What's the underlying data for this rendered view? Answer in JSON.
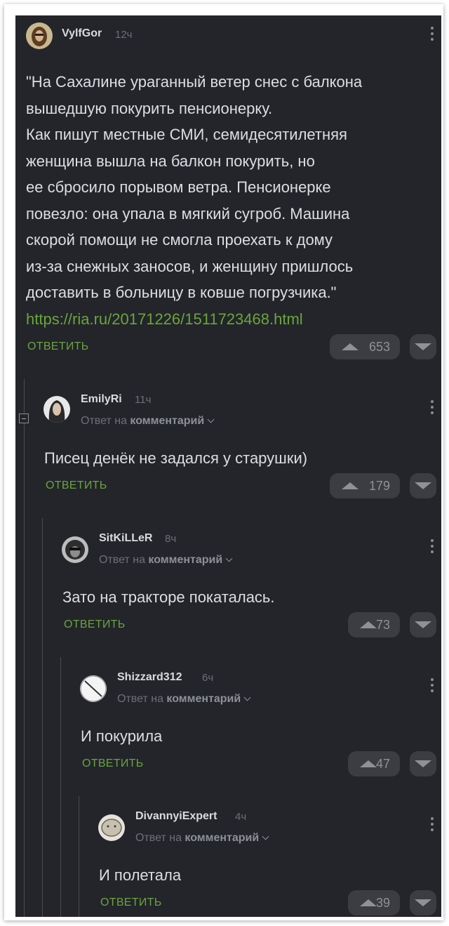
{
  "comments": [
    {
      "username": "VylfGor",
      "time": "12ч",
      "text_lines": [
        "\"На Сахалине ураганный ветер снес с балкона",
        "вышедшую покурить пенсионерку.",
        "Как пишут местные СМИ, семидесятилетняя",
        "женщина вышла на балкон покурить, но",
        "ее сбросило порывом ветра. Пенсионерке",
        "повезло: она упала в мягкий сугроб. Машина",
        "скорой помощи не смогла проехать к дому",
        "из-за снежных заносов, и женщину пришлось",
        "доставить в больницу в ковше погрузчика.\""
      ],
      "link": "https://ria.ru/20171226/1511723468.html",
      "reply_label": "ОТВЕТИТЬ",
      "votes": "653"
    },
    {
      "username": "EmilyRi",
      "time": "11ч",
      "reply_prefix": "Ответ на",
      "reply_target": "комментарий",
      "text": "Писец денёк не задался у старушки)",
      "reply_label": "ОТВЕТИТЬ",
      "votes": "179"
    },
    {
      "username": "SitKiLLeR",
      "time": "8ч",
      "reply_prefix": "Ответ на",
      "reply_target": "комментарий",
      "text": "Зато на тракторе покаталась.",
      "reply_label": "ОТВЕТИТЬ",
      "votes": "73"
    },
    {
      "username": "Shizzard312",
      "time": "6ч",
      "reply_prefix": "Ответ на",
      "reply_target": "комментарий",
      "text": "И покурила",
      "reply_label": "ОТВЕТИТЬ",
      "votes": "47"
    },
    {
      "username": "DivannyiExpert",
      "time": "4ч",
      "reply_prefix": "Ответ на",
      "reply_target": "комментарий",
      "text": "И полетала",
      "reply_label": "ОТВЕТИТЬ",
      "votes": "39"
    }
  ],
  "colors": {
    "background": "#23252b",
    "accent_green": "#6aa53b",
    "text": "#dcdee2",
    "muted": "#6d7077",
    "button": "#3b3d43"
  }
}
